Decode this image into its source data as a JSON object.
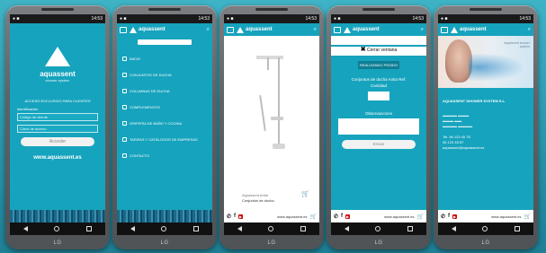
{
  "device_brand": "LG",
  "status_time": "14:53",
  "common": {
    "brand": "aquassent",
    "brand_sub": "shower system",
    "website": "www.aquassent.es"
  },
  "screen1": {
    "access_title": "ACCESO EXCLUSIVO PARA CLIENTES",
    "id_label": "Identificación",
    "code_placeholder": "Código de cliente",
    "pass_placeholder": "Clave de acceso",
    "login_button": "Acceder",
    "website": "www.aquassent.es"
  },
  "screen2": {
    "menu": [
      "INICIO",
      "CONJUNTOS DE DUCHA",
      "COLUMNAS DE DUCHA",
      "COMPLEMENTOS",
      "GRIFERÍA DE BAÑO Y COCINA",
      "TARIFAS Y CATÁLOGOS DE EMPRESAS",
      "CONTACTO"
    ]
  },
  "screen3": {
    "product_category": "Aquassent Antia",
    "product_name": "Conjuntos de ducha"
  },
  "screen4": {
    "close_label": "Cerrar ventana",
    "order_button": "REALIZANDO PEDIDO",
    "product_line": "Conjuntos de ducha Antia Ref.",
    "quantity_label": "Cantidad",
    "observations_label": "Observaciones",
    "send_button": "Enviar"
  },
  "screen5": {
    "tagline": "Aquassent shower system",
    "company_name": "AQUASSENT SHOWER SYSTEM S.L.",
    "phone1": "Tel. 96 123 45 78",
    "phone2": "96 123 45 67",
    "email": "aquassent@aquassent.es"
  },
  "colors": {
    "teal": "#16a3bd",
    "background": "#2a93a8"
  }
}
